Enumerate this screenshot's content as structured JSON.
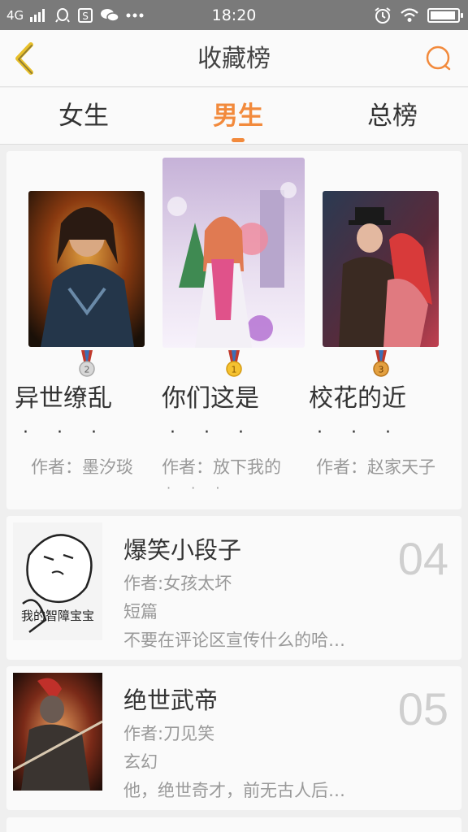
{
  "status_bar": {
    "network": "4G",
    "time": "18:20",
    "battery_level": 0.95,
    "icons": [
      "signal-icon",
      "qq-icon",
      "sim-icon",
      "wechat-icon",
      "more-icon",
      "alarm-icon",
      "wifi-icon",
      "battery-icon"
    ]
  },
  "header": {
    "title": "收藏榜",
    "back_icon": "chevron-left-icon",
    "search_icon": "search-icon"
  },
  "tabs": [
    {
      "label": "女生",
      "active": false
    },
    {
      "label": "男生",
      "active": true
    },
    {
      "label": "总榜",
      "active": false
    }
  ],
  "top3": [
    {
      "rank": 2,
      "title": "异世缭乱",
      "title_dots": "· · ·",
      "author": "作者：墨汐琰",
      "author_dots": ""
    },
    {
      "rank": 1,
      "title": "你们这是",
      "title_dots": "· · ·",
      "author": "作者：放下我的",
      "author_dots": "· · ·"
    },
    {
      "rank": 3,
      "title": "校花的近",
      "title_dots": "· · ·",
      "author": "作者：赵家天子",
      "author_dots": ""
    }
  ],
  "list": [
    {
      "title": "爆笑小段子",
      "author": "作者:女孩太坏",
      "genre": "短篇",
      "description": "不要在评论区宣传什么的哈…",
      "rank": "04",
      "cover_text": "我的智障宝宝"
    },
    {
      "title": "绝世武帝",
      "author": "作者:刀见笑",
      "genre": "玄幻",
      "description": "他，绝世奇才，前无古人后…",
      "rank": "05"
    }
  ],
  "colors": {
    "accent": "#f28a3c",
    "status_bar": "#7a7a7a",
    "background": "#efefef",
    "card": "#fafafa",
    "muted_text": "#999999",
    "rank_number": "#cfcfcf"
  }
}
